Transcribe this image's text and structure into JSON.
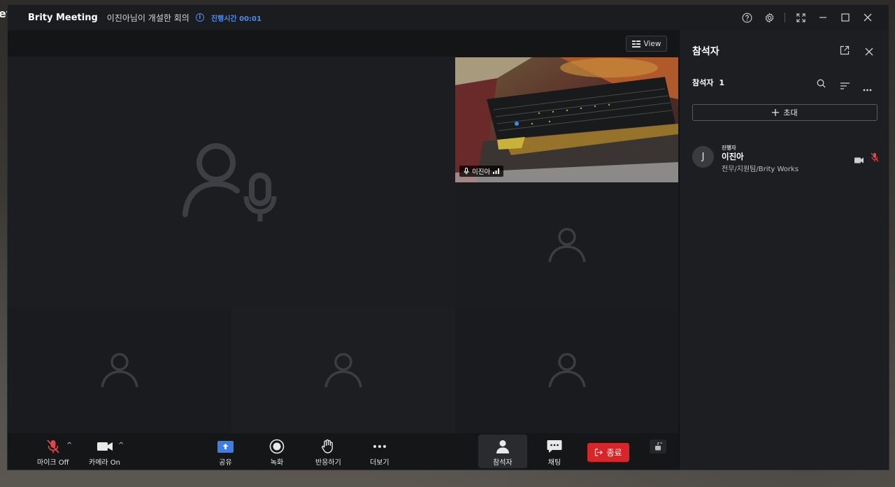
{
  "backdrop": {
    "edge_text": "et"
  },
  "titlebar": {
    "app_title": "Brity Meeting",
    "meeting_title": "이진아님이 개설한 회의",
    "info_glyph": "i",
    "elapsed": "진행시간 00:01",
    "controls": [
      "help-icon",
      "gear-icon",
      "fullscreen-icon",
      "minimize-icon",
      "maximize-icon",
      "close-icon"
    ]
  },
  "stage": {
    "view_button": "View",
    "camera_tile_label": "이진아"
  },
  "toolbar": {
    "mic_label": "마이크 Off",
    "camera_label": "카메라 On",
    "share_label": "공유",
    "record_label": "녹화",
    "reaction_label": "반응하기",
    "more_label": "더보기",
    "participants_label": "참석자",
    "chat_label": "채팅",
    "end_label": "종료",
    "caret": "^"
  },
  "panel": {
    "title": "참석자",
    "count_label": "참석자",
    "count": "1",
    "invite_label": "초대",
    "participant": {
      "initial": "J",
      "role": "진행자",
      "name": "이진아",
      "dept": "전무/지원팀/Brity Works"
    }
  },
  "colors": {
    "accent_blue": "#4a8cf0",
    "end_red": "#d6262a",
    "mic_off_red": "#e0474c",
    "share_blue": "#3d7de8"
  }
}
